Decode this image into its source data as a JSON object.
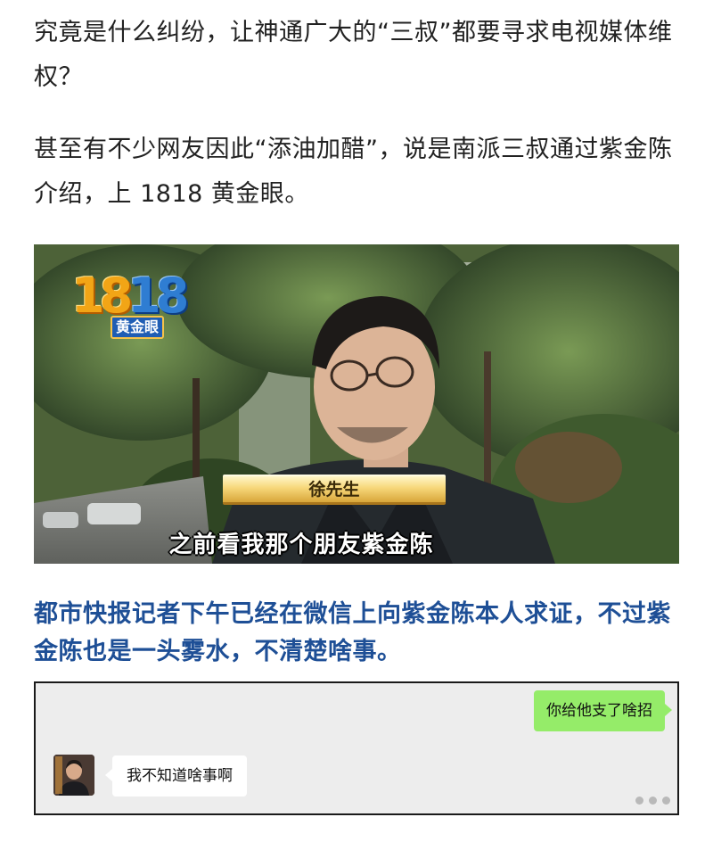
{
  "article": {
    "paragraph_1": "究竟是什么纠纷，让神通广大的“三叔”都要寻求电视媒体维权？",
    "paragraph_2": "甚至有不少网友因此“添油加醋”，说是南派三叔通过紫金陈介绍，上 1818 黄金眼。",
    "highlight_paragraph": "都市快报记者下午已经在微信上向紫金陈本人求证，不过紫金陈也是一头雾水，不清楚啥事。"
  },
  "video_frame": {
    "logo_number_part1": "18",
    "logo_number_part2": "18",
    "logo_subtitle": "黄金眼",
    "name_tag": "徐先生",
    "subtitle": "之前看我那个朋友紫金陈"
  },
  "chat": {
    "outgoing_message": "你给他支了啥招",
    "incoming_message": "我不知道啥事啊"
  },
  "colors": {
    "highlight_text": "#1e4f96",
    "outgoing_bubble": "#95ec69",
    "chat_background": "#ededed"
  }
}
